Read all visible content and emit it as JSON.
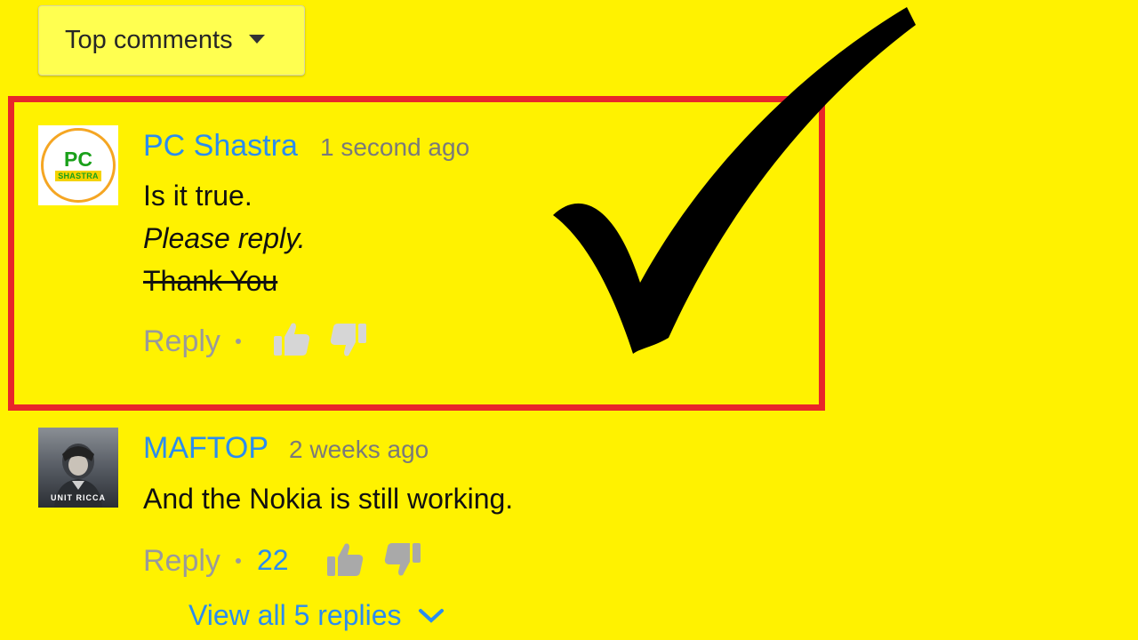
{
  "sort": {
    "label": "Top comments",
    "icon": "caret-down-icon"
  },
  "comments": [
    {
      "author": "PC Shastra",
      "time": "1 second ago",
      "avatar_text": [
        "PC",
        "SHASTRA"
      ],
      "lines": [
        "Is it true.",
        "Please reply.",
        "Thank You"
      ],
      "reply_label": "Reply",
      "likes": ""
    },
    {
      "author": "MAFTOP",
      "time": "2 weeks ago",
      "avatar_text": "UNIT RICCA",
      "lines": [
        "And the Nokia is still working."
      ],
      "reply_label": "Reply",
      "likes": "22",
      "view_replies": "View all 5 replies"
    }
  ],
  "colors": {
    "background": "#fff200",
    "highlight": "#e8262a",
    "author": "#2a8cf0",
    "checkmark": "#000000"
  },
  "icons": [
    "thumbs-up-icon",
    "thumbs-down-icon",
    "chevron-down-icon",
    "checkmark-icon"
  ]
}
